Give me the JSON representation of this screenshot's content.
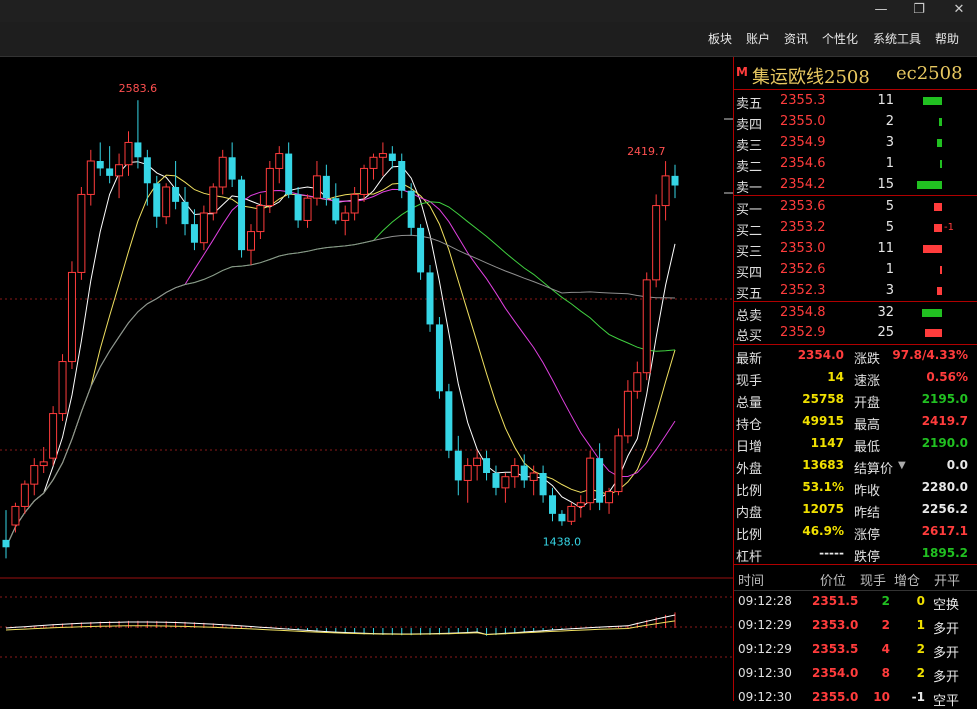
{
  "window": {
    "minimize": "—",
    "restore": "❐",
    "close": "✕"
  },
  "menu": [
    "板块",
    "账户",
    "资讯",
    "个性化",
    "系统工具",
    "帮助"
  ],
  "header": {
    "market_flag": "M",
    "name": "集运欧线2508",
    "code": "ec2508"
  },
  "order_book": {
    "asks": [
      {
        "label": "卖五",
        "price": "2355.3",
        "vol": "11",
        "bar": 0.55
      },
      {
        "label": "卖四",
        "price": "2355.0",
        "vol": "2",
        "bar": 0.1
      },
      {
        "label": "卖三",
        "price": "2354.9",
        "vol": "3",
        "bar": 0.15
      },
      {
        "label": "卖二",
        "price": "2354.6",
        "vol": "1",
        "bar": 0.06
      },
      {
        "label": "卖一",
        "price": "2354.2",
        "vol": "15",
        "bar": 0.75
      }
    ],
    "bids": [
      {
        "label": "买一",
        "price": "2353.6",
        "vol": "5",
        "bar": 0.25,
        "change": ""
      },
      {
        "label": "买二",
        "price": "2353.2",
        "vol": "5",
        "bar": 0.25,
        "change": "-1"
      },
      {
        "label": "买三",
        "price": "2353.0",
        "vol": "11",
        "bar": 0.55,
        "change": ""
      },
      {
        "label": "买四",
        "price": "2352.6",
        "vol": "1",
        "bar": 0.06,
        "change": ""
      },
      {
        "label": "买五",
        "price": "2352.3",
        "vol": "3",
        "bar": 0.15,
        "change": ""
      }
    ]
  },
  "totals": [
    {
      "label": "总卖",
      "value": "2354.8",
      "vol": "32",
      "color": "green",
      "bar": 0.6
    },
    {
      "label": "总买",
      "value": "2352.9",
      "vol": "25",
      "color": "red",
      "bar": 0.5
    }
  ],
  "stats_left": [
    {
      "label": "最新",
      "value": "2354.0",
      "color": "red"
    },
    {
      "label": "现手",
      "value": "14",
      "color": "yellow"
    },
    {
      "label": "总量",
      "value": "25758",
      "color": "yellow"
    },
    {
      "label": "持仓",
      "value": "49915",
      "color": "yellow"
    },
    {
      "label": "日增",
      "value": "1147",
      "color": "yellow"
    },
    {
      "label": "外盘",
      "value": "13683",
      "color": "yellow"
    },
    {
      "label": "比例",
      "value": "53.1%",
      "color": "yellow"
    },
    {
      "label": "内盘",
      "value": "12075",
      "color": "yellow"
    },
    {
      "label": "比例",
      "value": "46.9%",
      "color": "yellow"
    },
    {
      "label": "杠杆",
      "value": "-----",
      "color": "white"
    }
  ],
  "stats_right": [
    {
      "label": "涨跌",
      "value": "97.8/4.33%",
      "color": "red"
    },
    {
      "label": "速涨",
      "value": "0.56%",
      "color": "red"
    },
    {
      "label": "开盘",
      "value": "2195.0",
      "color": "green"
    },
    {
      "label": "最高",
      "value": "2419.7",
      "color": "red"
    },
    {
      "label": "最低",
      "value": "2190.0",
      "color": "green"
    },
    {
      "label": "结算价",
      "value": "0.0",
      "color": "white",
      "dropdown": "▼"
    },
    {
      "label": "昨收",
      "value": "2280.0",
      "color": "white"
    },
    {
      "label": "昨结",
      "value": "2256.2",
      "color": "white"
    },
    {
      "label": "涨停",
      "value": "2617.1",
      "color": "red"
    },
    {
      "label": "跌停",
      "value": "1895.2",
      "color": "green"
    }
  ],
  "trades": {
    "headers": [
      "时间",
      "价位",
      "现手",
      "增仓",
      "开平"
    ],
    "rows": [
      {
        "time": "09:12:28",
        "price": "2351.5",
        "vol": "2",
        "oi": "0",
        "type": "空换",
        "pc": "red",
        "vc": "green",
        "oc": "yellow"
      },
      {
        "time": "09:12:29",
        "price": "2353.0",
        "vol": "2",
        "oi": "1",
        "type": "多开",
        "pc": "red",
        "vc": "red",
        "oc": "yellow"
      },
      {
        "time": "09:12:29",
        "price": "2353.5",
        "vol": "4",
        "oi": "2",
        "type": "多开",
        "pc": "red",
        "vc": "red",
        "oc": "yellow"
      },
      {
        "time": "09:12:30",
        "price": "2354.0",
        "vol": "8",
        "oi": "2",
        "type": "多开",
        "pc": "red",
        "vc": "red",
        "oc": "yellow"
      },
      {
        "time": "09:12:30",
        "price": "2355.0",
        "vol": "10",
        "oi": "-1",
        "type": "空平",
        "pc": "red",
        "vc": "red",
        "oc": "white"
      }
    ]
  },
  "chart_data": {
    "type": "candlestick",
    "annotations": [
      {
        "label": "2583.6",
        "kind": "high"
      },
      {
        "label": "2419.7",
        "kind": "high"
      },
      {
        "label": "1438.0",
        "kind": "low"
      }
    ],
    "price_range": [
      1300,
      2700
    ],
    "candles": [
      [
        1400,
        1480,
        1350,
        1380
      ],
      [
        1440,
        1500,
        1420,
        1490
      ],
      [
        1490,
        1560,
        1470,
        1550
      ],
      [
        1550,
        1620,
        1520,
        1600
      ],
      [
        1600,
        1650,
        1580,
        1610
      ],
      [
        1620,
        1760,
        1600,
        1740
      ],
      [
        1740,
        1900,
        1720,
        1880
      ],
      [
        1880,
        2150,
        1860,
        2120
      ],
      [
        2120,
        2350,
        2100,
        2330
      ],
      [
        2330,
        2450,
        2300,
        2420
      ],
      [
        2420,
        2470,
        2380,
        2400
      ],
      [
        2400,
        2460,
        2360,
        2380
      ],
      [
        2380,
        2440,
        2320,
        2410
      ],
      [
        2410,
        2500,
        2380,
        2470
      ],
      [
        2470,
        2583.6,
        2400,
        2430
      ],
      [
        2430,
        2450,
        2300,
        2360
      ],
      [
        2360,
        2380,
        2240,
        2270
      ],
      [
        2270,
        2360,
        2250,
        2350
      ],
      [
        2350,
        2420,
        2290,
        2310
      ],
      [
        2310,
        2350,
        2220,
        2250
      ],
      [
        2250,
        2290,
        2180,
        2200
      ],
      [
        2200,
        2300,
        2180,
        2280
      ],
      [
        2280,
        2360,
        2260,
        2350
      ],
      [
        2350,
        2450,
        2330,
        2430
      ],
      [
        2430,
        2470,
        2350,
        2370
      ],
      [
        2370,
        2380,
        2160,
        2180
      ],
      [
        2180,
        2250,
        2140,
        2230
      ],
      [
        2230,
        2330,
        2210,
        2300
      ],
      [
        2300,
        2420,
        2280,
        2400
      ],
      [
        2400,
        2460,
        2360,
        2440
      ],
      [
        2440,
        2470,
        2320,
        2330
      ],
      [
        2330,
        2350,
        2240,
        2260
      ],
      [
        2260,
        2330,
        2240,
        2320
      ],
      [
        2320,
        2420,
        2300,
        2380
      ],
      [
        2380,
        2410,
        2300,
        2320
      ],
      [
        2320,
        2360,
        2250,
        2260
      ],
      [
        2260,
        2300,
        2220,
        2280
      ],
      [
        2280,
        2350,
        2260,
        2330
      ],
      [
        2330,
        2410,
        2310,
        2400
      ],
      [
        2400,
        2440,
        2370,
        2430
      ],
      [
        2430,
        2470,
        2380,
        2440
      ],
      [
        2440,
        2460,
        2400,
        2420
      ],
      [
        2420,
        2440,
        2320,
        2340
      ],
      [
        2340,
        2360,
        2220,
        2240
      ],
      [
        2240,
        2250,
        2100,
        2120
      ],
      [
        2120,
        2140,
        1960,
        1980
      ],
      [
        1980,
        2000,
        1780,
        1800
      ],
      [
        1800,
        1820,
        1620,
        1640
      ],
      [
        1640,
        1680,
        1520,
        1560
      ],
      [
        1560,
        1620,
        1500,
        1600
      ],
      [
        1600,
        1640,
        1560,
        1620
      ],
      [
        1620,
        1640,
        1560,
        1580
      ],
      [
        1580,
        1600,
        1520,
        1540
      ],
      [
        1540,
        1580,
        1500,
        1570
      ],
      [
        1570,
        1620,
        1540,
        1600
      ],
      [
        1600,
        1630,
        1540,
        1560
      ],
      [
        1560,
        1600,
        1520,
        1580
      ],
      [
        1580,
        1600,
        1500,
        1520
      ],
      [
        1520,
        1540,
        1450,
        1470
      ],
      [
        1470,
        1480,
        1438,
        1450
      ],
      [
        1450,
        1500,
        1440,
        1490
      ],
      [
        1490,
        1520,
        1460,
        1500
      ],
      [
        1500,
        1640,
        1480,
        1620
      ],
      [
        1620,
        1660,
        1480,
        1500
      ],
      [
        1500,
        1540,
        1470,
        1530
      ],
      [
        1530,
        1700,
        1520,
        1680
      ],
      [
        1680,
        1830,
        1660,
        1800
      ],
      [
        1800,
        1880,
        1780,
        1850
      ],
      [
        1850,
        2120,
        1830,
        2100
      ],
      [
        2100,
        2330,
        2080,
        2300
      ],
      [
        2300,
        2419.7,
        2260,
        2380
      ],
      [
        2380,
        2410,
        2320,
        2354
      ]
    ]
  }
}
